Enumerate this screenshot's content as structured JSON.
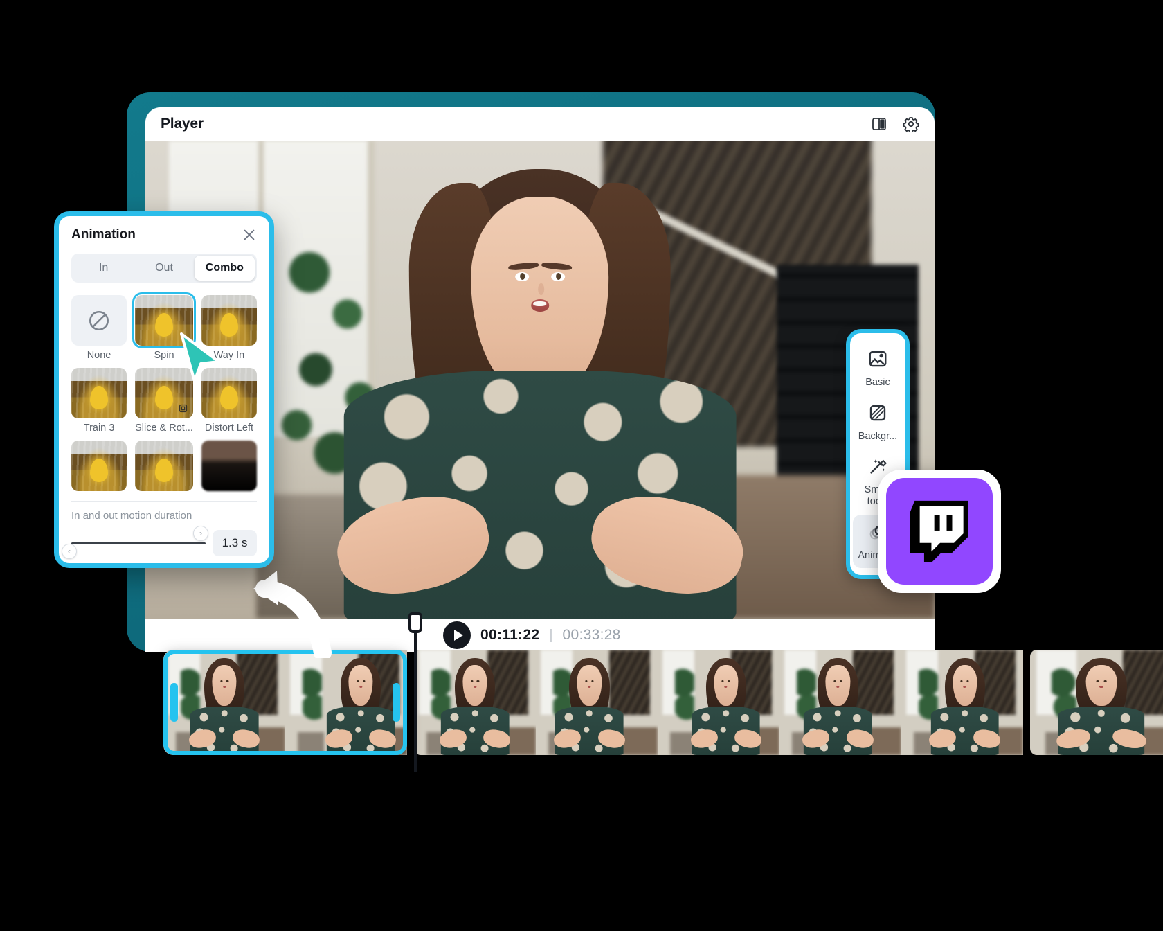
{
  "window": {
    "player_title": "Player",
    "header_icons": [
      {
        "name": "split-view-icon",
        "label": "Split view"
      },
      {
        "name": "settings-gear-icon",
        "label": "Settings"
      }
    ]
  },
  "accent_colors": {
    "cyan": "#25c3ef",
    "teal_frame": "#127a8c",
    "twitch_purple": "#9147ff",
    "cursor_teal": "#2ec4b6",
    "dark": "#14181f"
  },
  "animation_panel": {
    "title": "Animation",
    "close_label": "×",
    "tabs": [
      {
        "label": "In",
        "active": false
      },
      {
        "label": "Out",
        "active": false
      },
      {
        "label": "Combo",
        "active": true
      }
    ],
    "presets": [
      {
        "label": "None",
        "kind": "none",
        "selected": false
      },
      {
        "label": "Spin",
        "kind": "leaf",
        "selected": true
      },
      {
        "label": "Way In",
        "kind": "leaf",
        "selected": false
      },
      {
        "label": "Train 3",
        "kind": "leaf",
        "selected": false
      },
      {
        "label": "Slice & Rot...",
        "kind": "leaf",
        "selected": false
      },
      {
        "label": "Distort Left",
        "kind": "leaf",
        "selected": false
      },
      {
        "label": "",
        "kind": "leaf",
        "selected": false
      },
      {
        "label": "",
        "kind": "leaf",
        "selected": false
      },
      {
        "label": "",
        "kind": "dark",
        "selected": false
      }
    ],
    "duration": {
      "label": "In and out motion duration",
      "value": "1.3 s",
      "slider_percent": 92,
      "decrease_label": "‹",
      "increase_label": "›"
    }
  },
  "tool_sidebar": {
    "items": [
      {
        "label": "Basic",
        "icon": "image-icon",
        "active": false
      },
      {
        "label": "Backgr...",
        "icon": "background-icon",
        "active": false
      },
      {
        "label": "Smart\ntools",
        "icon": "magic-wand-icon",
        "active": false
      },
      {
        "label": "Animat...",
        "icon": "animation-rings-icon",
        "active": true
      }
    ]
  },
  "playback": {
    "play_label": "▶",
    "current_time": "00:11:22",
    "separator": "|",
    "total_time": "00:33:28"
  },
  "timeline": {
    "selected_clip_frames": 2,
    "other_clip_frames": 6
  },
  "badge": {
    "name": "twitch-logo",
    "platform": "Twitch"
  }
}
